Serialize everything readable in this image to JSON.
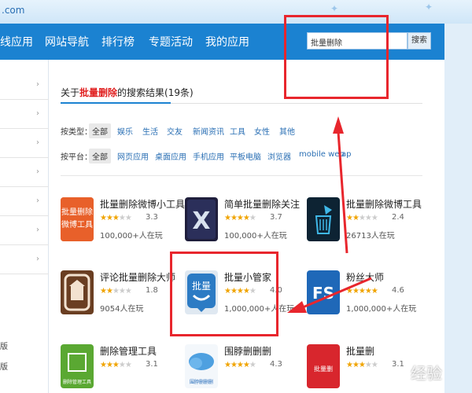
{
  "topbar": {
    "url_fragment": ".com"
  },
  "nav": {
    "items": [
      {
        "label": "线应用"
      },
      {
        "label": "网站导航"
      },
      {
        "label": "排行榜"
      },
      {
        "label": "专题活动"
      },
      {
        "label": "我的应用"
      }
    ],
    "search_value": "批量删除",
    "search_button": "搜索"
  },
  "sidebar": {
    "bottom_texts": [
      "版",
      "版"
    ]
  },
  "results": {
    "prefix": "关于",
    "keyword": "批量删除",
    "middle": "的搜索结果",
    "count": "(19条)"
  },
  "filters": {
    "type_label": "按类型：",
    "types": [
      "全部",
      "娱乐",
      "生活",
      "交友",
      "新闻资讯",
      "工具",
      "女性",
      "其他"
    ],
    "platform_label": "按平台：",
    "platforms": [
      "全部",
      "网页应用",
      "桌面应用",
      "手机应用",
      "平板电脑",
      "浏览器",
      "mobile web",
      "ap"
    ]
  },
  "apps": [
    {
      "name": "批量删除微博小工具",
      "rating": "3.3",
      "users": "100,000+人在玩",
      "icon_text": "批量删除\n微博工具",
      "icon_color": "#e8602a"
    },
    {
      "name": "简单批量删除关注",
      "rating": "3.7",
      "users": "100,000+人在玩",
      "icon_text": "X",
      "icon_color": "#1f1e3c"
    },
    {
      "name": "批量删除微博工具",
      "rating": "2.4",
      "users": "26713人在玩",
      "icon_text": "",
      "icon_color": "#0d2333"
    },
    {
      "name": "评论批量删除大师",
      "rating": "1.8",
      "users": "9054人在玩",
      "icon_text": "",
      "icon_color": "#6a3e22"
    },
    {
      "name": "批量小管家",
      "rating": "4.0",
      "users": "1,000,000+人在玩",
      "icon_text": "批量",
      "icon_color": "#2c7bc4"
    },
    {
      "name": "粉丝大师",
      "rating": "4.6",
      "users": "1,000,000+人在玩",
      "icon_text": "FS",
      "icon_color": "#1f68b8"
    },
    {
      "name": "删除管理工具",
      "rating": "3.1",
      "users": "",
      "icon_text": "删除管理工具",
      "icon_color": "#5aa832"
    },
    {
      "name": "围脖删删删",
      "rating": "4.3",
      "users": "",
      "icon_text": "围脖删删删",
      "icon_color": "#e8f2fa"
    },
    {
      "name": "批量删",
      "rating": "3.1",
      "users": "",
      "icon_text": "批量删",
      "icon_color": "#d8262d"
    }
  ],
  "watermark": "经验"
}
